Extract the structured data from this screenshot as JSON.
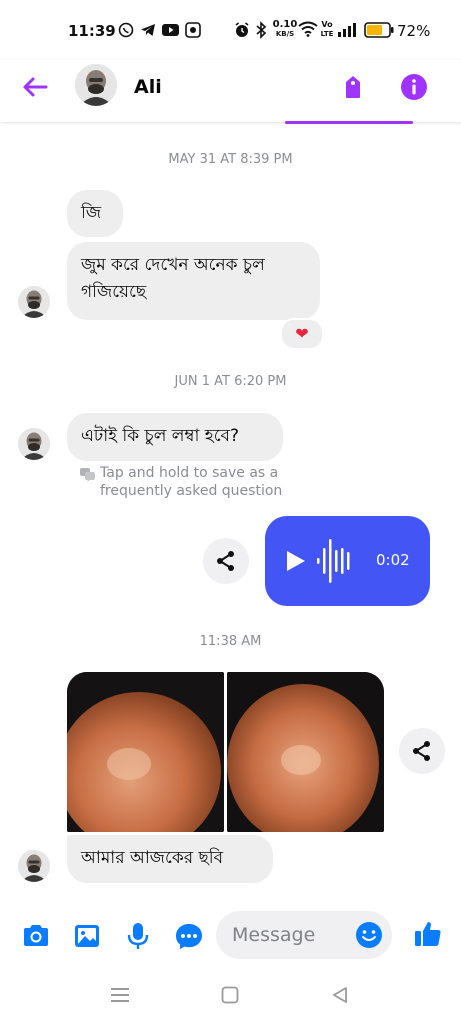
{
  "status_bar": {
    "time": "11:39",
    "network_speed_top": "0.10",
    "network_speed_bottom": "KB/S",
    "volte_top": "Vo",
    "volte_bottom": "LTE",
    "battery_percent": "72%",
    "battery_level": 0.72
  },
  "header": {
    "contact_name": "Ali",
    "accent_color": "#a033ff"
  },
  "messages": {
    "stamp1": "MAY 31 AT 8:39 PM",
    "msg1": "জি",
    "msg2_line1": "জুম করে দেখেন অনেক চুল",
    "msg2_line2": "গজিয়েছে",
    "reaction": "❤",
    "stamp2": "JUN 1 AT 6:20 PM",
    "msg3": "এটাই কি চুল লম্বা হবে?",
    "hint_line1": "Tap and hold to save as a",
    "hint_line2": "frequently asked question",
    "voice_duration": "0:02",
    "voice_color": "#4355f5",
    "stamp3": "11:38 AM",
    "msg4": "আমার আজকের ছবি"
  },
  "composer": {
    "placeholder": "Message",
    "icon_color": "#0a7cff"
  },
  "icons": [
    "back-arrow-icon",
    "tag-icon",
    "info-icon",
    "share-icon",
    "play-icon",
    "camera-icon",
    "gallery-icon",
    "mic-icon",
    "chat-icon",
    "emoji-icon",
    "thumbs-up-icon",
    "menu-icon",
    "home-icon",
    "back-icon"
  ]
}
